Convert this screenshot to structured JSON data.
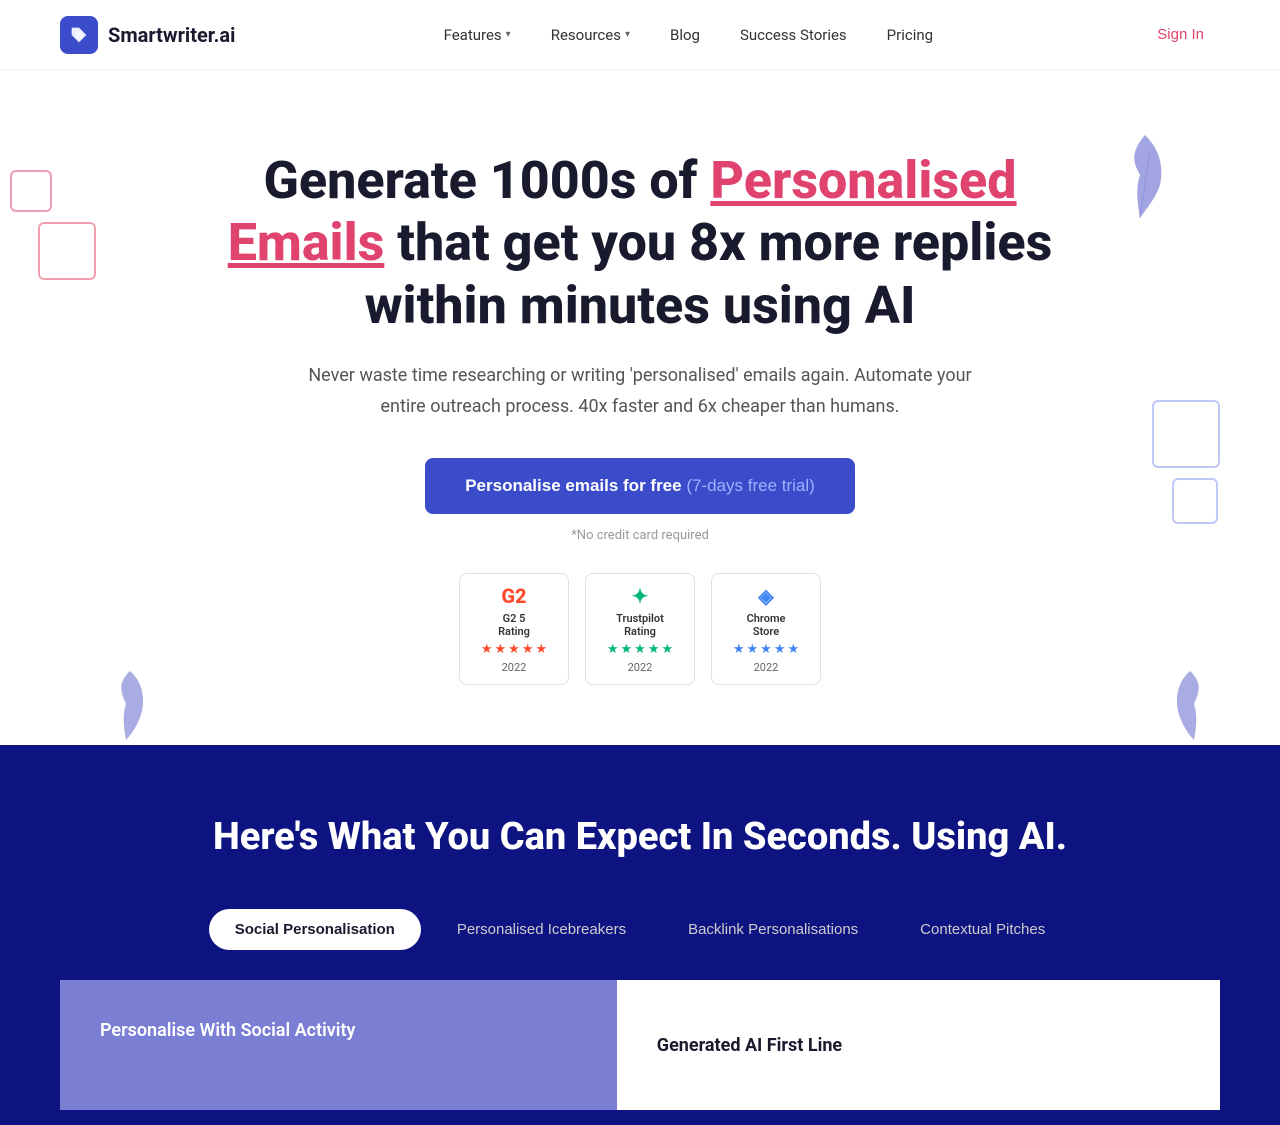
{
  "nav": {
    "logo_text": "Smartwriter.ai",
    "links": [
      {
        "label": "Features",
        "has_dropdown": true
      },
      {
        "label": "Resources",
        "has_dropdown": true
      },
      {
        "label": "Blog",
        "has_dropdown": false
      },
      {
        "label": "Success Stories",
        "has_dropdown": false
      },
      {
        "label": "Pricing",
        "has_dropdown": false
      }
    ],
    "signin_label": "Sign In"
  },
  "hero": {
    "title_start": "Generate 1000s of ",
    "title_highlight": "Personalised Emails",
    "title_end": " that get you 8x more replies within minutes using AI",
    "subtitle": "Never waste time researching or writing 'personalised' emails again. Automate your entire outreach process. 40x faster and 6x cheaper than humans.",
    "cta_label": "Personalise emails for free",
    "cta_trial": " (7-days free trial)",
    "no_cc": "*No credit card required"
  },
  "ratings": [
    {
      "logo": "G2",
      "type": "g2",
      "label": "G2 5\nRating",
      "year": "2022"
    },
    {
      "logo": "✦",
      "type": "tp",
      "label": "Trustpilot\nRating",
      "year": "2022"
    },
    {
      "logo": "◈",
      "type": "cs",
      "label": "Chrome\nStore",
      "year": "2022"
    }
  ],
  "dark_section": {
    "title": "Here's What You Can Expect In Seconds. Using AI.",
    "tabs": [
      {
        "label": "Social Personalisation",
        "active": true
      },
      {
        "label": "Personalised Icebreakers",
        "active": false
      },
      {
        "label": "Backlink Personalisations",
        "active": false
      },
      {
        "label": "Contextual Pitches",
        "active": false
      }
    ],
    "panel_left_title": "Personalise With Social Activity",
    "panel_right_label": "Generated AI First Line"
  }
}
